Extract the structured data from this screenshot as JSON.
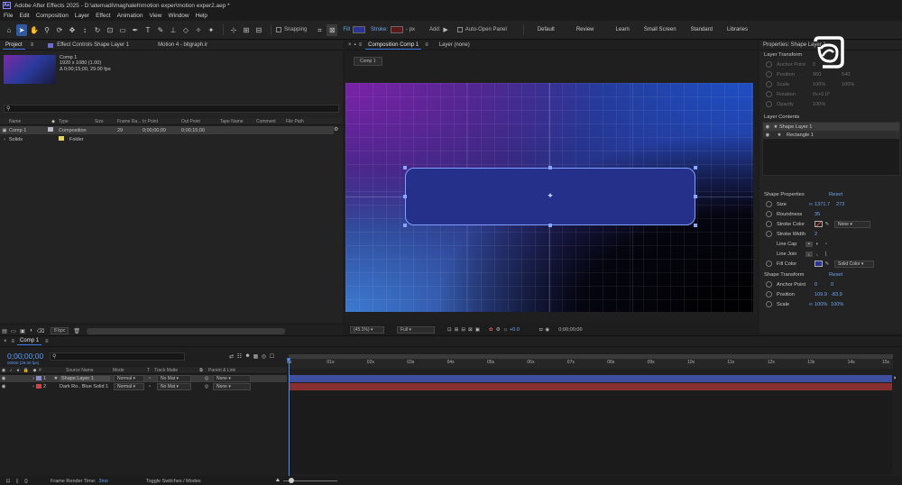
{
  "window": {
    "title": "Adobe After Effects 2025 - D:\\atemadi\\maghaleh\\motion exper\\motion exper2.aep *",
    "logo": "Ae"
  },
  "menu": [
    "File",
    "Edit",
    "Composition",
    "Layer",
    "Effect",
    "Animation",
    "View",
    "Window",
    "Help"
  ],
  "toolbar": {
    "snapping": "Snapping",
    "fill": "Fill",
    "stroke": "Stroke:",
    "stroke_px": "- px",
    "add": "Add:",
    "auto_open": "Auto-Open Panel",
    "workspaces": [
      "Default",
      "Review",
      "Learn",
      "Small Screen",
      "Standard",
      "Libraries"
    ],
    "overlay_text": "Shape Layer 1",
    "colors": {
      "fill": "#2a3494",
      "stroke": "#5a1a1a"
    }
  },
  "project": {
    "tab": "Project",
    "effect_controls": "Effect Controls Shape Layer 1",
    "motion_tab": "Motion 4 - bitgraph.ir",
    "thumb_name": "Comp 1",
    "thumb_info1": "1920 x 1080 (1.00)",
    "thumb_info2": "Δ 0;00;15;00, 29.00 fps",
    "search_placeholder": "",
    "columns": [
      "Name",
      "Type",
      "Size",
      "Frame Ra...",
      "In Point",
      "Out Point",
      "Tape Name",
      "Comment",
      "File Path"
    ],
    "rows": [
      {
        "name": "Comp 1",
        "type": "Composition",
        "fr": "29",
        "in": "0;00;00;00",
        "out": "0;00;15;00",
        "color": "#b8b8c8"
      },
      {
        "name": "Solids",
        "type": "Folder",
        "fr": "",
        "in": "",
        "out": "",
        "color": "#e5d45a"
      }
    ],
    "bpc": "8 bpc"
  },
  "comp": {
    "tab": "Composition Comp 1",
    "layer_tab": "Layer (none)",
    "breadcrumb": "Comp 1",
    "zoom": "(45.1%)",
    "quality": "Full",
    "exposure": "+0.0",
    "timecode": "0;00;00;00"
  },
  "properties": {
    "header": "Properties: Shape Layer 1",
    "layer_transform_title": "Layer Transform",
    "layer_transform": [
      {
        "label": "Anchor Point",
        "v1": "0",
        "v2": "0"
      },
      {
        "label": "Position",
        "v1": "960",
        "v2": "540"
      },
      {
        "label": "Scale",
        "v1": "100%",
        "v2": "100%"
      },
      {
        "label": "Rotation",
        "v1": "0x+0.0°",
        "v2": ""
      },
      {
        "label": "Opacity",
        "v1": "100%",
        "v2": ""
      }
    ],
    "layer_contents_title": "Layer Contents",
    "contents": [
      "Shape Layer 1",
      "Rectangle 1"
    ],
    "shape_props_title": "Shape Properties",
    "reset": "Reset",
    "size_label": "Size",
    "size_w": "1371.7",
    "size_h": "273",
    "round_label": "Roundness",
    "round_val": "35",
    "stroke_color_label": "Stroke Color",
    "stroke_none": "None",
    "stroke_width_label": "Stroke Width",
    "stroke_width_val": "2",
    "linecap_label": "Line Cap",
    "linejoin_label": "Line Join",
    "fill_color_label": "Fill Color",
    "fill_type": "Solid Color",
    "shape_transform_title": "Shape Transform",
    "anchor_label": "Anchor Point",
    "anchor_x": "0",
    "anchor_y": "0",
    "pos_label": "Position",
    "pos_x": "109.9",
    "pos_y": "-83.9",
    "scale_label": "Scale",
    "scale_x": "100%",
    "scale_y": "100%",
    "colors": {
      "fill_swatch": "#2a3494"
    }
  },
  "timeline": {
    "tab": "Comp 1",
    "timecode": "0;00;00;00",
    "timecode_sub": "00000 (29.00 fps)",
    "columns": [
      "#",
      "Source Name",
      "Mode",
      "T",
      "Track Matte",
      "Parent & Link"
    ],
    "layers": [
      {
        "num": "1",
        "name": "Shape Layer 1",
        "mode": "Normal",
        "matte": "No Mat",
        "parent": "None",
        "label": "#8a8ac8",
        "bar": "#3e4fa0"
      },
      {
        "num": "2",
        "name": "Dark Ro.. Blue Solid 1",
        "mode": "Normal",
        "matte": "No Mat",
        "parent": "None",
        "label": "#c84848",
        "bar": "#8a2f2f"
      }
    ],
    "ruler": [
      "0s",
      "01s",
      "02s",
      "03s",
      "04s",
      "05s",
      "06s",
      "07s",
      "08s",
      "09s",
      "10s",
      "11s",
      "12s",
      "13s",
      "14s",
      "15s"
    ],
    "render_label": "Frame Render Time:",
    "render_value": "2ms",
    "toggle": "Toggle Switches / Modes"
  }
}
